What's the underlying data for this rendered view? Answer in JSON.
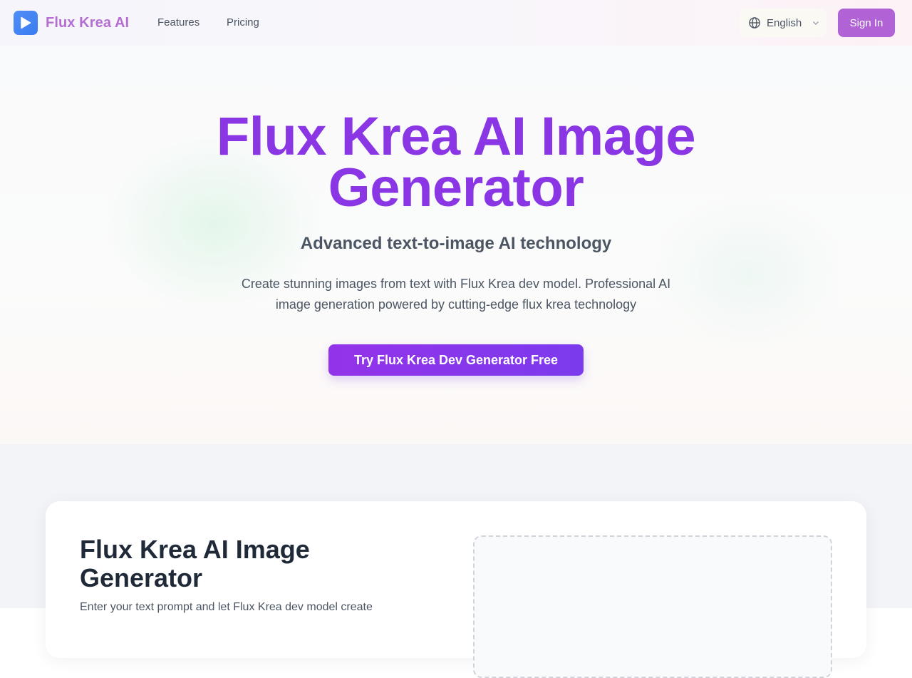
{
  "nav": {
    "brand": "Flux Krea AI",
    "links": [
      {
        "label": "Features"
      },
      {
        "label": "Pricing"
      }
    ],
    "language": "English",
    "sign_in": "Sign In"
  },
  "hero": {
    "title": "Flux Krea AI Image Generator",
    "subtitle": "Advanced text-to-image AI technology",
    "description": "Create stunning images from text with Flux Krea dev model. Professional AI image generation powered by cutting-edge flux krea technology",
    "cta": "Try Flux Krea Dev Generator Free"
  },
  "generator": {
    "title": "Flux Krea AI Image Generator",
    "description": "Enter your text prompt and let Flux Krea dev model create"
  },
  "colors": {
    "brand_text": "#b46ed1",
    "logo_blue": "#3b7cf0",
    "accent_purple": "#8a36e4",
    "sign_in_bg": "#b163d6"
  },
  "icons": {
    "logo": "play-icon",
    "language": "globe-icon",
    "dropdown": "chevron-down-icon"
  }
}
